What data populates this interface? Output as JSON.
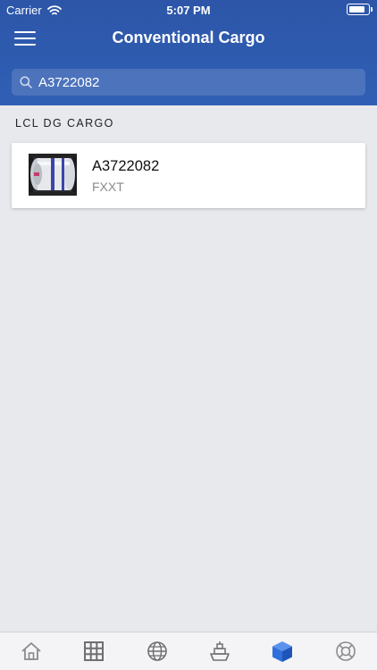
{
  "status": {
    "carrier": "Carrier",
    "time": "5:07 PM"
  },
  "header": {
    "title": "Conventional Cargo"
  },
  "search": {
    "value": "A3722082",
    "placeholder": ""
  },
  "section": {
    "title": "LCL DG CARGO"
  },
  "results": [
    {
      "id": "A3722082",
      "subtitle": "FXXT"
    }
  ],
  "tabs": [
    {
      "icon": "home-icon",
      "active": false
    },
    {
      "icon": "grid-icon",
      "active": false
    },
    {
      "icon": "globe-icon",
      "active": false
    },
    {
      "icon": "ship-icon",
      "active": false
    },
    {
      "icon": "cube-icon",
      "active": true
    },
    {
      "icon": "lifebuoy-icon",
      "active": false
    }
  ],
  "colors": {
    "accent": "#2f5fb4",
    "tab_active": "#2e6fdc",
    "tab_inactive": "#8a8a8e"
  }
}
